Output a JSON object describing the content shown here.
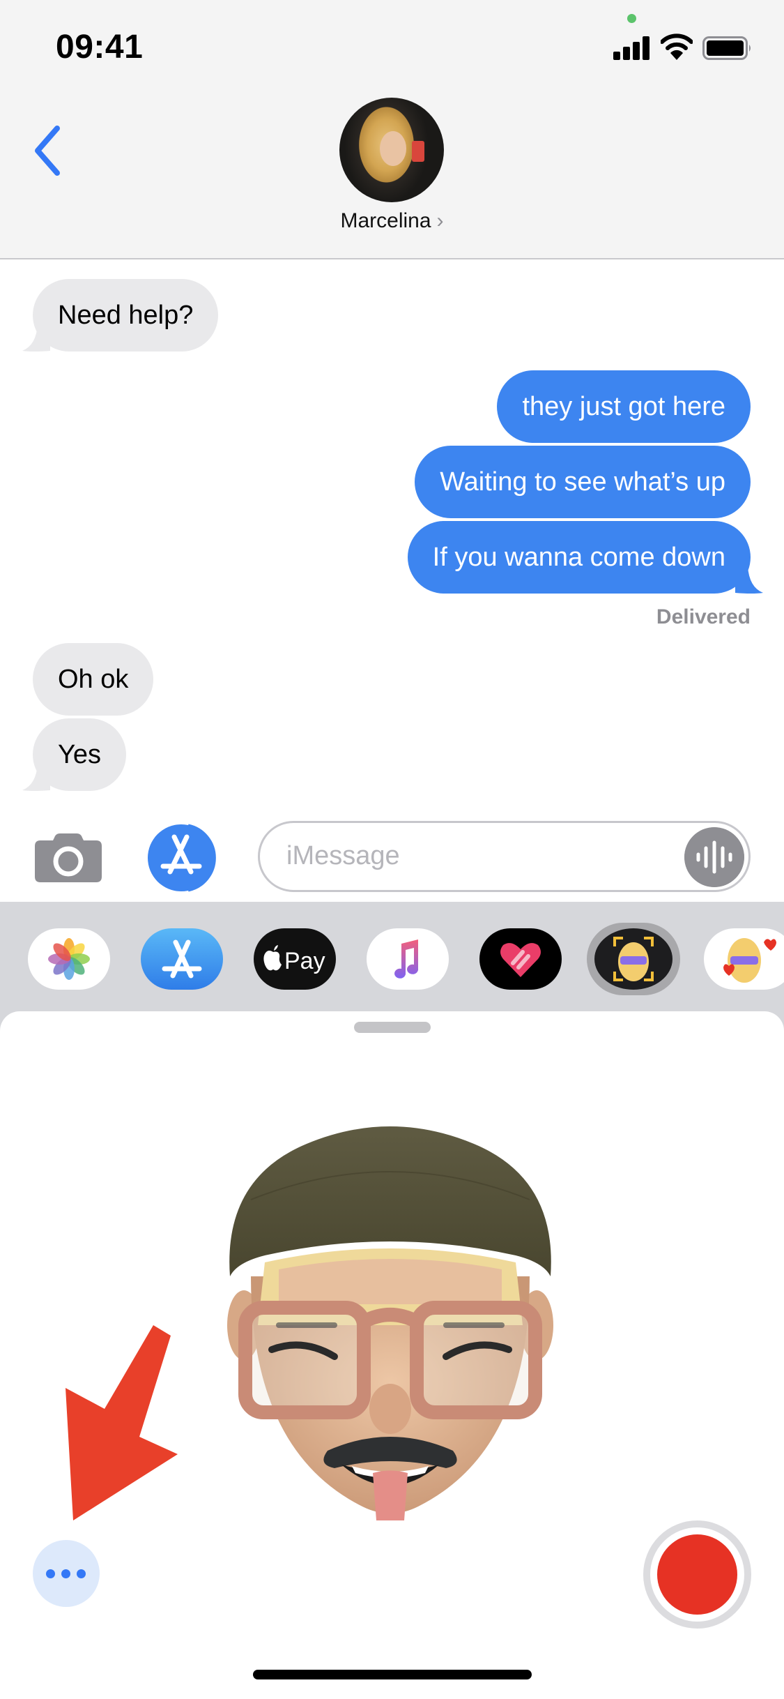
{
  "status_bar": {
    "time": "09:41",
    "icons": [
      "signal-icon",
      "wifi-icon",
      "battery-icon"
    ],
    "camera_indicator_color": "#5bc36b"
  },
  "header": {
    "back_icon": "chevron-left-icon",
    "contact_name": "Marcelina",
    "contact_chevron": "›",
    "avatar": "contact-photo"
  },
  "conversation": {
    "messages": [
      {
        "direction": "incoming",
        "text": "Need help?"
      },
      {
        "direction": "outgoing",
        "text": "they just got here"
      },
      {
        "direction": "outgoing",
        "text": "Waiting to see what’s up"
      },
      {
        "direction": "outgoing",
        "text": "If you wanna come down"
      },
      {
        "direction": "incoming",
        "text": "Oh ok"
      },
      {
        "direction": "incoming",
        "text": "Yes"
      }
    ],
    "delivery_status": "Delivered"
  },
  "composer": {
    "camera_icon": "camera-icon",
    "apps_icon": "app-store-icon",
    "placeholder": "iMessage",
    "audio_icon": "waveform-icon"
  },
  "app_drawer": {
    "apps": [
      {
        "name": "Photos",
        "icon": "photos-icon"
      },
      {
        "name": "App Store",
        "icon": "app-store-icon"
      },
      {
        "name": "Apple Pay",
        "icon": "apple-pay-icon",
        "label": "Pay"
      },
      {
        "name": "Music",
        "icon": "music-icon"
      },
      {
        "name": "Digital Touch",
        "icon": "digital-touch-icon"
      },
      {
        "name": "Animoji",
        "icon": "animoji-icon",
        "selected": true
      },
      {
        "name": "Memoji Stickers",
        "icon": "memoji-stickers-icon"
      }
    ]
  },
  "memoji_panel": {
    "character": "memoji-face",
    "more_button_icon": "ellipsis-icon",
    "record_button_icon": "record-icon",
    "annotation": "red-arrow-pointing-to-more-button"
  },
  "colors": {
    "outgoing_bubble": "#3d85f0",
    "incoming_bubble": "#e9e9eb",
    "accent": "#3478f6",
    "record": "#e63224",
    "arrow": "#e8402a"
  }
}
